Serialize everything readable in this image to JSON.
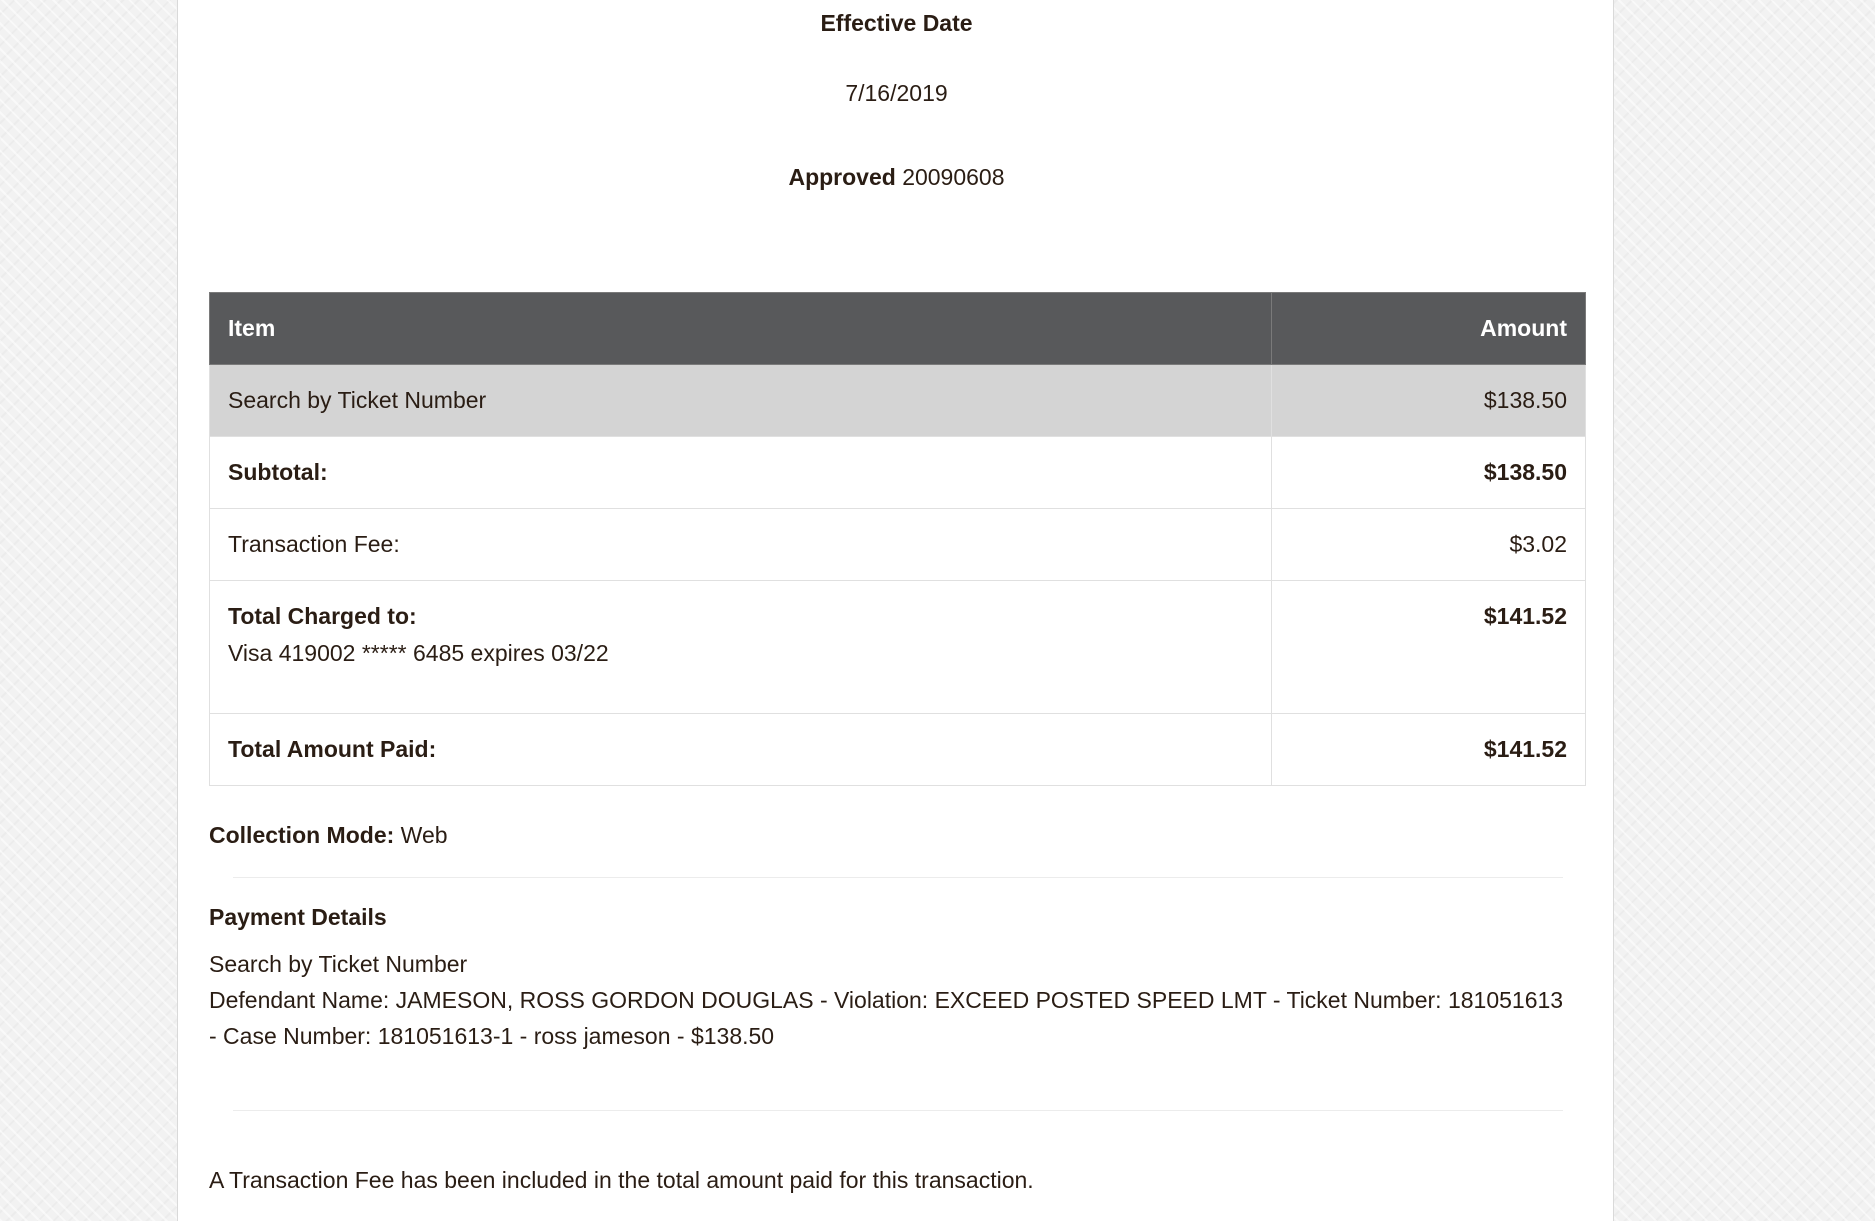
{
  "header": {
    "effective_date_label": "Effective Date",
    "effective_date": "7/16/2019",
    "approved_label": "Approved",
    "approved_code": "20090608"
  },
  "table": {
    "columns": [
      "Item",
      "Amount"
    ],
    "line_item": {
      "label": "Search by Ticket Number",
      "amount": "$138.50"
    },
    "subtotal": {
      "label": "Subtotal:",
      "amount": "$138.50"
    },
    "fee": {
      "label": "Transaction Fee:",
      "amount": "$3.02"
    },
    "total_charged": {
      "label": "Total Charged to:",
      "card": "Visa 419002 ***** 6485 expires 03/22",
      "amount": "$141.52"
    },
    "total_paid": {
      "label": "Total Amount Paid:",
      "amount": "$141.52"
    }
  },
  "collection": {
    "label": "Collection Mode:",
    "value": "Web"
  },
  "payment_details": {
    "title": "Payment Details",
    "line1": "Search by Ticket Number",
    "line2": "Defendant Name: JAMESON, ROSS GORDON DOUGLAS - Violation: EXCEED POSTED SPEED LMT - Ticket Number: 181051613 - Case Number: 181051613-1 - ross jameson - $138.50"
  },
  "footnote": "A Transaction Fee has been included in the total amount paid for this transaction.",
  "colors": {
    "header_bg": "#58595b",
    "shaded_row": "#d4d4d4",
    "text": "#2a1d14"
  }
}
